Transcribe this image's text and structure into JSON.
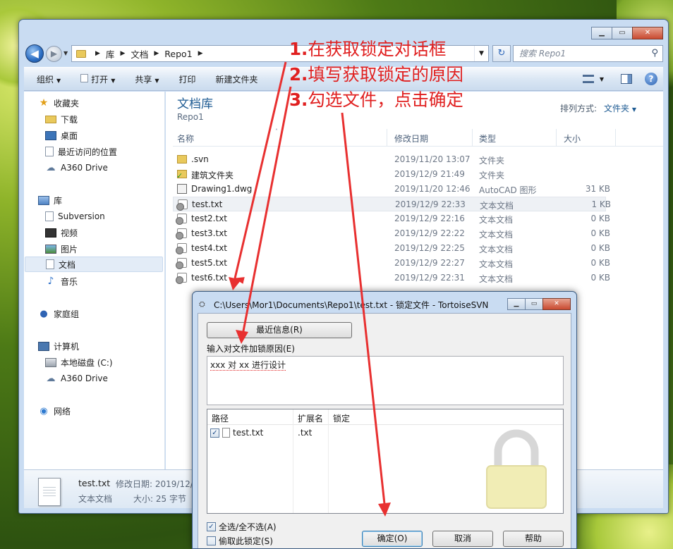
{
  "explorer": {
    "breadcrumb": [
      "库",
      "文档",
      "Repo1"
    ],
    "search_placeholder": "搜索 Repo1",
    "toolbar": {
      "organize": "组织",
      "open": "打开",
      "share": "共享",
      "print": "打印",
      "new_folder": "新建文件夹"
    },
    "sidebar": {
      "favorites": "收藏夹",
      "downloads": "下载",
      "desktop": "桌面",
      "recent": "最近访问的位置",
      "a360_fav": "A360 Drive",
      "libraries": "库",
      "subversion": "Subversion",
      "videos": "视频",
      "pictures": "图片",
      "documents": "文档",
      "music": "音乐",
      "homegroup": "家庭组",
      "computer": "计算机",
      "local_disk": "本地磁盘 (C:)",
      "a360_pc": "A360 Drive",
      "network": "网络"
    },
    "library_title": "文档库",
    "library_subtitle": "Repo1",
    "arrange_label": "排列方式:",
    "arrange_value": "文件夹",
    "columns": {
      "name": "名称",
      "date": "修改日期",
      "type": "类型",
      "size": "大小"
    },
    "files": [
      {
        "name": ".svn",
        "date": "2019/11/20 13:07",
        "type": "文件夹",
        "size": ""
      },
      {
        "name": "建筑文件夹",
        "date": "2019/12/9 21:49",
        "type": "文件夹",
        "size": ""
      },
      {
        "name": "Drawing1.dwg",
        "date": "2019/11/20 12:46",
        "type": "AutoCAD 图形",
        "size": "31 KB"
      },
      {
        "name": "test.txt",
        "date": "2019/12/9 22:33",
        "type": "文本文档",
        "size": "1 KB"
      },
      {
        "name": "test2.txt",
        "date": "2019/12/9 22:16",
        "type": "文本文档",
        "size": "0 KB"
      },
      {
        "name": "test3.txt",
        "date": "2019/12/9 22:22",
        "type": "文本文档",
        "size": "0 KB"
      },
      {
        "name": "test4.txt",
        "date": "2019/12/9 22:25",
        "type": "文本文档",
        "size": "0 KB"
      },
      {
        "name": "test5.txt",
        "date": "2019/12/9 22:27",
        "type": "文本文档",
        "size": "0 KB"
      },
      {
        "name": "test6.txt",
        "date": "2019/12/9 22:31",
        "type": "文本文档",
        "size": "0 KB"
      }
    ],
    "details": {
      "name": "test.txt",
      "modified": "修改日期: 2019/12/",
      "type": "文本文档",
      "size": "大小: 25 字节"
    }
  },
  "annotations": [
    {
      "num": "1.",
      "text": "在获取锁定对话框"
    },
    {
      "num": "2.",
      "text": "填写获取锁定的原因"
    },
    {
      "num": "3.",
      "text": "勾选文件，点击确定"
    }
  ],
  "dialog": {
    "title": "C:\\Users\\Mor1\\Documents\\Repo1\\test.txt - 锁定文件 - TortoiseSVN",
    "recent_button": "最近信息(R)",
    "message_label": "输入对文件加锁原因(E)",
    "message": "xxx 对 xx 进行设计",
    "list_columns": {
      "path": "路径",
      "ext": "扩展名",
      "lock": "锁定"
    },
    "list_items": [
      {
        "path": "test.txt",
        "ext": ".txt",
        "checked": true
      }
    ],
    "select_all": "全选/全不选(A)",
    "steal_lock": "偷取此锁定(S)",
    "ok": "确定(O)",
    "cancel": "取消",
    "help": "帮助"
  },
  "colors": {
    "annotation": "#e02020",
    "library_title": "#1e5b93"
  }
}
